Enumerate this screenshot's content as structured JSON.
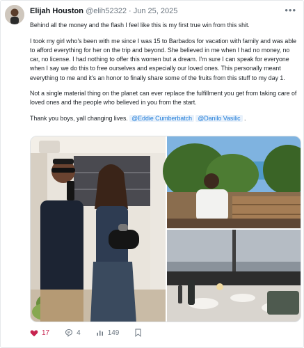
{
  "post": {
    "author_name": "Elijah Houston",
    "author_handle": "@elih52322",
    "separator": "·",
    "date": "Jun 25, 2025",
    "paragraphs": [
      "Behind all the money and the flash I feel like this is my first true win from this shit.",
      "I took my girl who's been with me since I was 15 to Barbados for vacation with family and was able to afford everything for her on the trip and beyond. She believed in me when I had no money, no car, no license. I had nothing to offer this women but a dream. I'm sure I can speak for everyone when I say we do this to free ourselves and especially our loved ones. This personally meant everything to me and it's an honor to finally share some of the fruits from this stuff to my day 1.",
      "Not a single material thing on the planet can ever replace the fulfillment you get from taking care of loved ones and the people who believed in you from the start."
    ],
    "closing_text": "Thank you boys, yall changing lives.",
    "mentions": [
      "@Eddie Cumberbatch",
      "@Danilo Vasilic"
    ],
    "closing_punct": "."
  },
  "actions": {
    "likes": "17",
    "replies": "4",
    "views": "149"
  },
  "colors": {
    "like": "#c7234f",
    "mention": "#1d7bd8",
    "muted": "#6b7680"
  },
  "icons": [
    "more-icon",
    "heart-icon",
    "reply-icon",
    "views-icon",
    "bookmark-icon"
  ]
}
